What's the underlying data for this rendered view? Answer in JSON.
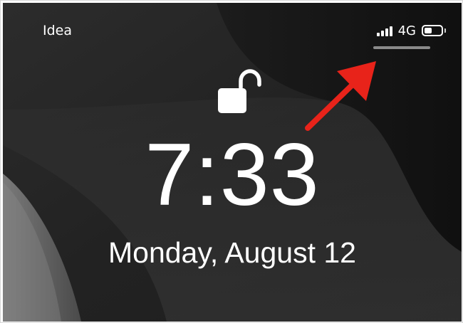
{
  "status_bar": {
    "carrier": "Idea",
    "network": "4G",
    "signal_bars": 4,
    "battery_level": 0.45
  },
  "lock_screen": {
    "lock_state": "unlocked",
    "time": "7:33",
    "date": "Monday, August 12"
  },
  "annotation": {
    "arrow_color": "#e8231a",
    "arrow_target": "control-center-indicator"
  },
  "colors": {
    "wallpaper_dark": "#1b1b1b",
    "wallpaper_mid": "#3a3a3a",
    "text": "#ffffff"
  }
}
